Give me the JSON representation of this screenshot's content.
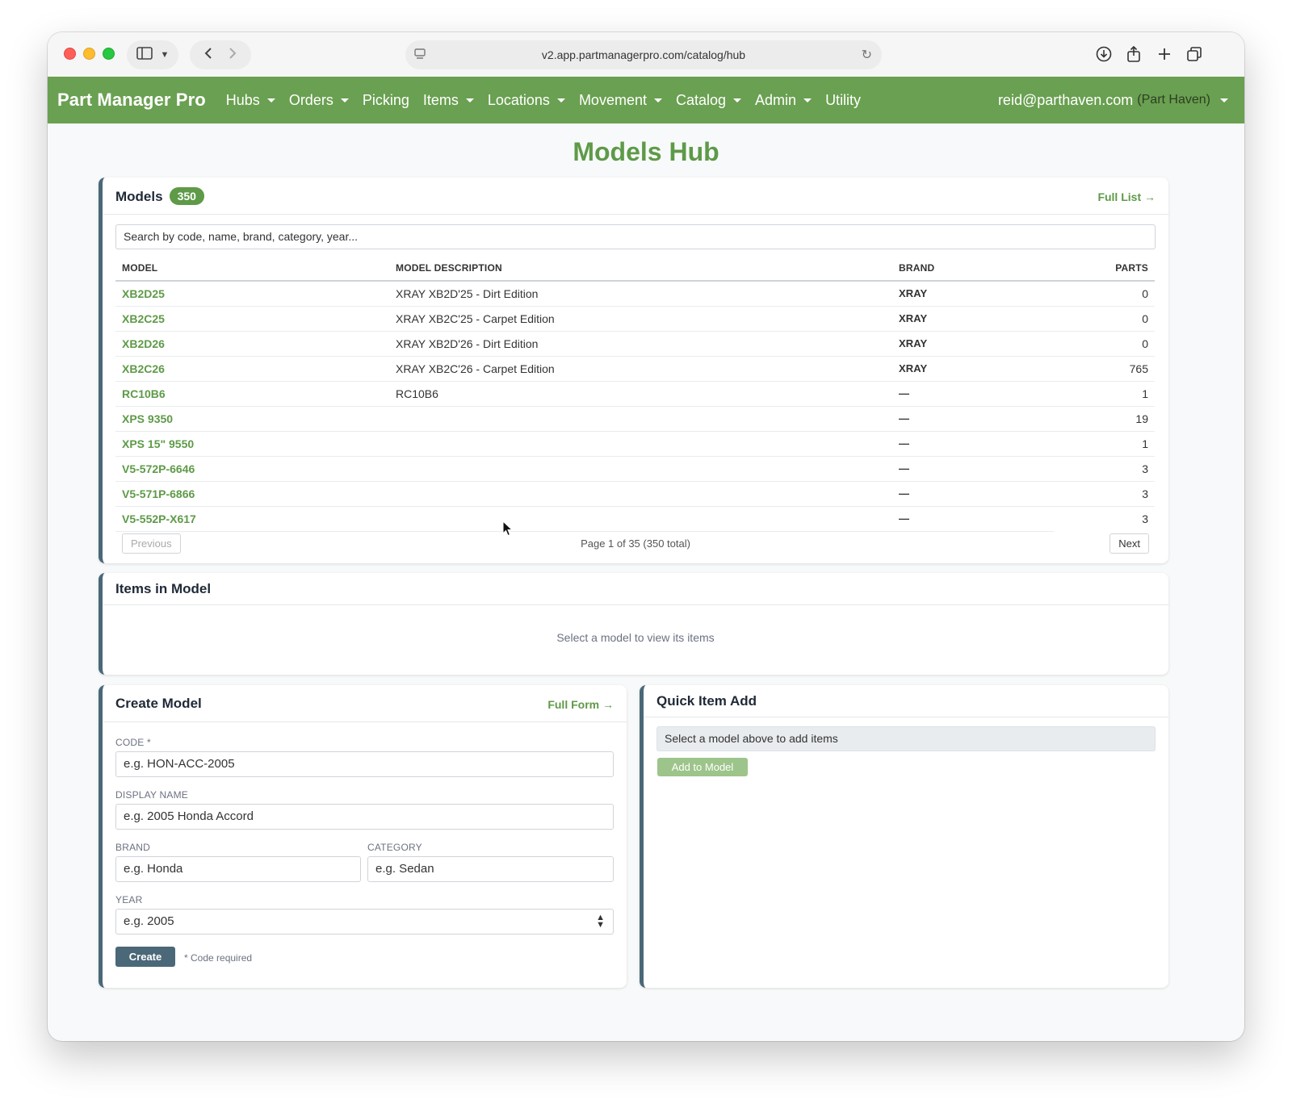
{
  "browser": {
    "url": "v2.app.partmanagerpro.com/catalog/hub"
  },
  "navbar": {
    "brand": "Part Manager Pro",
    "items": [
      {
        "label": "Hubs",
        "dropdown": true
      },
      {
        "label": "Orders",
        "dropdown": true
      },
      {
        "label": "Picking",
        "dropdown": false
      },
      {
        "label": "Items",
        "dropdown": true
      },
      {
        "label": "Locations",
        "dropdown": true
      },
      {
        "label": "Movement",
        "dropdown": true
      },
      {
        "label": "Catalog",
        "dropdown": true
      },
      {
        "label": "Admin",
        "dropdown": true
      },
      {
        "label": "Utility",
        "dropdown": false
      }
    ],
    "user_email": "reid@parthaven.com",
    "user_org": "(Part Haven)"
  },
  "page": {
    "title": "Models Hub"
  },
  "models_card": {
    "title": "Models",
    "count": "350",
    "full_list_link": "Full List →",
    "search_placeholder": "Search by code, name, brand, category, year...",
    "columns": {
      "model": "MODEL",
      "description": "MODEL DESCRIPTION",
      "brand": "BRAND",
      "parts": "PARTS"
    },
    "rows": [
      {
        "model": "XB2D25",
        "description": "XRAY XB2D'25 - Dirt Edition",
        "brand": "XRAY",
        "parts": "0"
      },
      {
        "model": "XB2C25",
        "description": "XRAY XB2C'25 - Carpet Edition",
        "brand": "XRAY",
        "parts": "0"
      },
      {
        "model": "XB2D26",
        "description": "XRAY XB2D'26 - Dirt Edition",
        "brand": "XRAY",
        "parts": "0"
      },
      {
        "model": "XB2C26",
        "description": "XRAY XB2C'26 - Carpet Edition",
        "brand": "XRAY",
        "parts": "765"
      },
      {
        "model": "RC10B6",
        "description": "RC10B6",
        "brand": "—",
        "parts": "1"
      },
      {
        "model": "XPS 9350",
        "description": "",
        "brand": "—",
        "parts": "19"
      },
      {
        "model": "XPS 15\" 9550",
        "description": "",
        "brand": "—",
        "parts": "1"
      },
      {
        "model": "V5-572P-6646",
        "description": "",
        "brand": "—",
        "parts": "3"
      },
      {
        "model": "V5-571P-6866",
        "description": "",
        "brand": "—",
        "parts": "3"
      },
      {
        "model": "V5-552P-X617",
        "description": "",
        "brand": "—",
        "parts": "3"
      }
    ],
    "pagination": {
      "previous": "Previous",
      "info": "Page 1 of 35 (350 total)",
      "next": "Next"
    }
  },
  "items_card": {
    "title": "Items in Model",
    "empty": "Select a model to view its items"
  },
  "create_card": {
    "title": "Create Model",
    "full_form_link": "Full Form →",
    "fields": {
      "code_label": "CODE *",
      "code_placeholder": "e.g. HON-ACC-2005",
      "name_label": "DISPLAY NAME",
      "name_placeholder": "e.g. 2005 Honda Accord",
      "brand_label": "BRAND",
      "brand_placeholder": "e.g. Honda",
      "category_label": "CATEGORY",
      "category_placeholder": "e.g. Sedan",
      "year_label": "YEAR",
      "year_placeholder": "e.g. 2005"
    },
    "create_button": "Create",
    "hint": "* Code required"
  },
  "quick_add_card": {
    "title": "Quick Item Add",
    "select_placeholder": "Select a model above to add items",
    "add_button": "Add to Model"
  },
  "colors": {
    "navbar": "#6aa051",
    "accent": "#5e9a48",
    "card_border": "#4a6878"
  }
}
